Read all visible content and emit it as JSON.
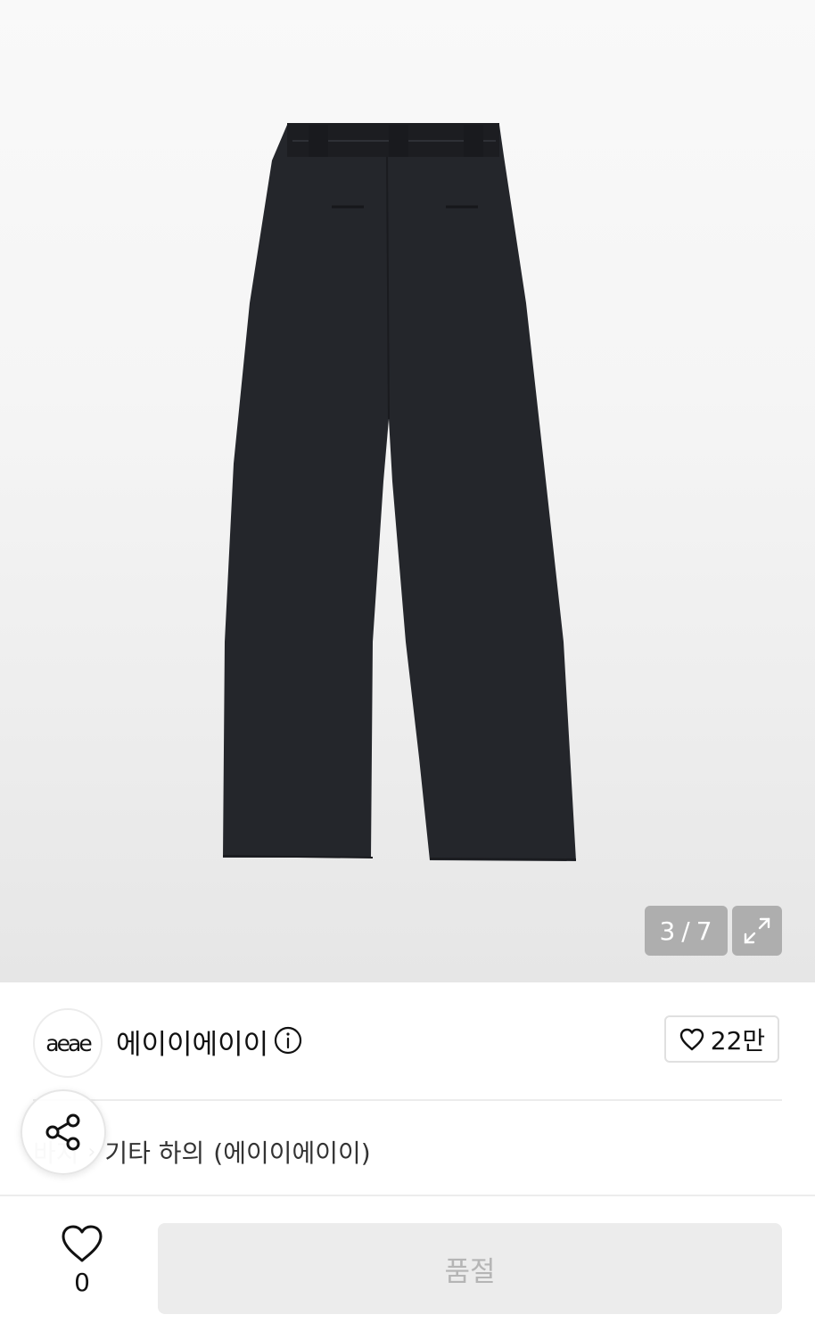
{
  "gallery": {
    "current_index": "3",
    "separator": "/",
    "total": "7"
  },
  "brand": {
    "logo_text": "aeae",
    "name": "에이이에이이"
  },
  "brand_likes": "22만",
  "breadcrumb": {
    "parent": "바지",
    "category": "기타 하의",
    "brand_suffix": "(에이이에이이)"
  },
  "product_likes": "0",
  "purchase_button_label": "품절",
  "icons": [
    "expand-icon",
    "info-icon",
    "heart-icon",
    "share-icon"
  ],
  "colors": {
    "sold_out_bg": "#ececec",
    "sold_out_text": "#b5b5b5"
  }
}
